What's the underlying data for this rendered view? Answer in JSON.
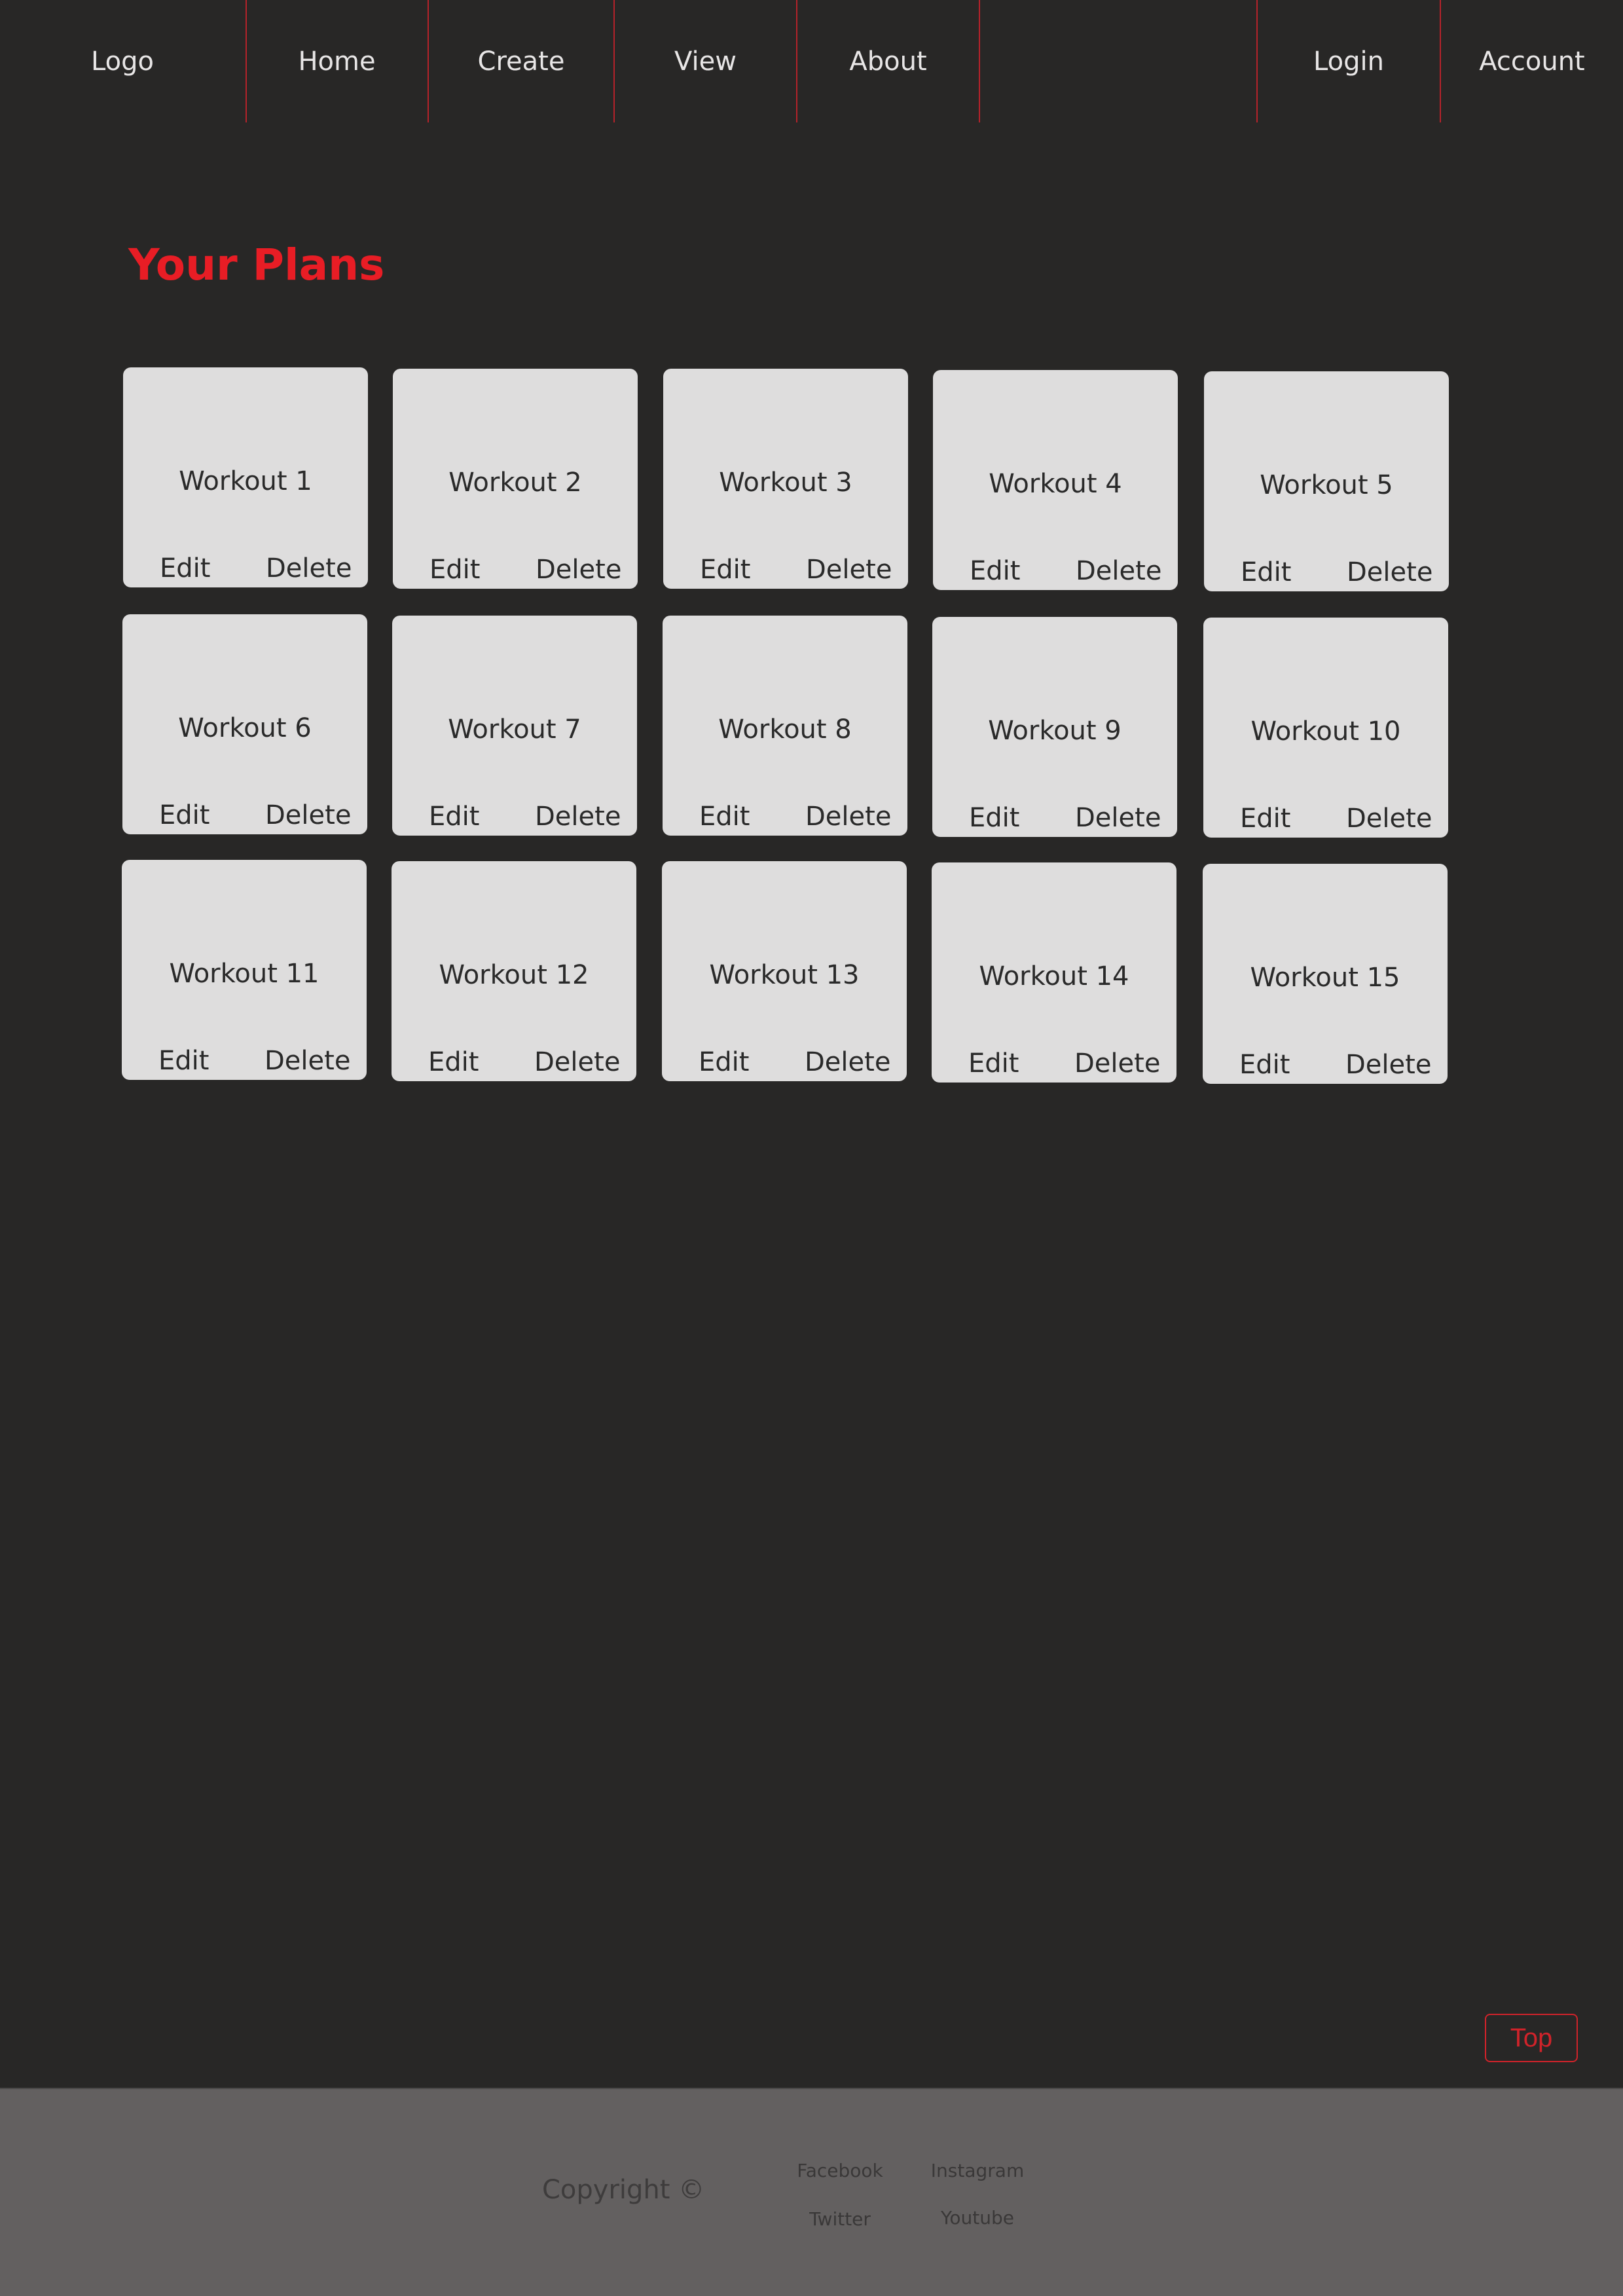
{
  "nav": {
    "logo": "Logo",
    "home": "Home",
    "create": "Create",
    "view": "View",
    "about": "About",
    "login": "Login",
    "account": "Account"
  },
  "page": {
    "title": "Your Plans"
  },
  "cards": [
    {
      "title": "Workout 1",
      "edit": "Edit",
      "delete": "Delete"
    },
    {
      "title": "Workout 2",
      "edit": "Edit",
      "delete": "Delete"
    },
    {
      "title": "Workout 3",
      "edit": "Edit",
      "delete": "Delete"
    },
    {
      "title": "Workout 4",
      "edit": "Edit",
      "delete": "Delete"
    },
    {
      "title": "Workout 5",
      "edit": "Edit",
      "delete": "Delete"
    },
    {
      "title": "Workout 6",
      "edit": "Edit",
      "delete": "Delete"
    },
    {
      "title": "Workout 7",
      "edit": "Edit",
      "delete": "Delete"
    },
    {
      "title": "Workout 8",
      "edit": "Edit",
      "delete": "Delete"
    },
    {
      "title": "Workout 9",
      "edit": "Edit",
      "delete": "Delete"
    },
    {
      "title": "Workout 10",
      "edit": "Edit",
      "delete": "Delete"
    },
    {
      "title": "Workout 11",
      "edit": "Edit",
      "delete": "Delete"
    },
    {
      "title": "Workout 12",
      "edit": "Edit",
      "delete": "Delete"
    },
    {
      "title": "Workout 13",
      "edit": "Edit",
      "delete": "Delete"
    },
    {
      "title": "Workout 14",
      "edit": "Edit",
      "delete": "Delete"
    },
    {
      "title": "Workout 15",
      "edit": "Edit",
      "delete": "Delete"
    }
  ],
  "top_button": {
    "label": "Top"
  },
  "footer": {
    "copyright": "Copyright ©",
    "facebook": "Facebook",
    "instagram": "Instagram",
    "twitter": "Twitter",
    "youtube": "Youtube"
  },
  "colors": {
    "background": "#282726",
    "accent": "#e81d25",
    "divider": "#b5222a",
    "card": "#dedddd",
    "footer": "#636060"
  }
}
